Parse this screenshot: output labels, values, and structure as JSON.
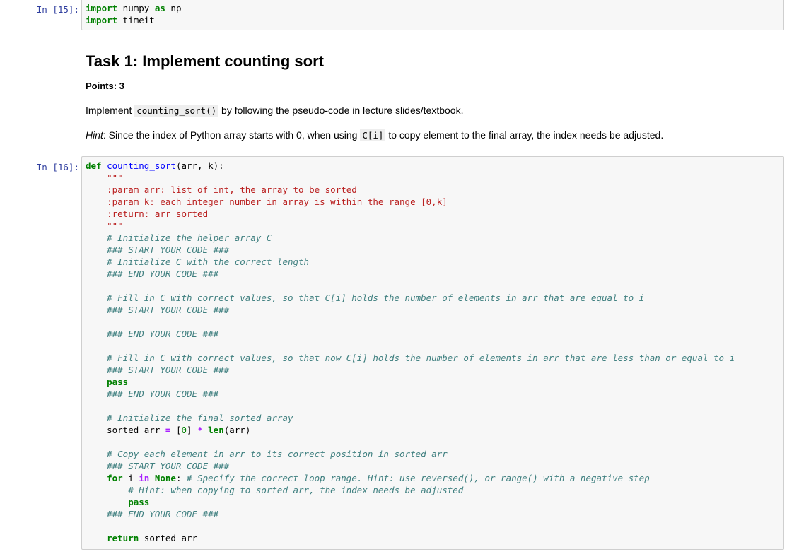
{
  "cell1": {
    "prompt": "In [15]:",
    "lines": [
      [
        [
          "kw",
          "import"
        ],
        [
          "t",
          " numpy "
        ],
        [
          "kw",
          "as"
        ],
        [
          "t",
          " np"
        ]
      ],
      [
        [
          "kw",
          "import"
        ],
        [
          "t",
          " timeit"
        ]
      ]
    ]
  },
  "markdown": {
    "title": "Task 1: Implement counting sort",
    "points": "Points: 3",
    "p1_before": "Implement ",
    "p1_code": "counting_sort()",
    "p1_after": " by following the pseudo-code in lecture slides/textbook.",
    "hint_label": "Hint",
    "hint_before": ": Since the index of Python array starts with 0, when using ",
    "hint_code": "C[i]",
    "hint_after": " to copy element to the final array, the index needs be adjusted."
  },
  "cell2": {
    "prompt": "In [16]:",
    "lines": [
      [
        [
          "kw",
          "def"
        ],
        [
          "t",
          " "
        ],
        [
          "fn",
          "counting_sort"
        ],
        [
          "t",
          "(arr, k):"
        ]
      ],
      [
        [
          "str",
          "    \"\"\""
        ]
      ],
      [
        [
          "str",
          "    :param arr: list of int, the array to be sorted"
        ]
      ],
      [
        [
          "str",
          "    :param k: each integer number in array is within the range [0,k]"
        ]
      ],
      [
        [
          "str",
          "    :return: arr sorted"
        ]
      ],
      [
        [
          "str",
          "    \"\"\""
        ]
      ],
      [
        [
          "cm",
          "    # Initialize the helper array C"
        ]
      ],
      [
        [
          "cm",
          "    ### START YOUR CODE ###"
        ]
      ],
      [
        [
          "cm",
          "    # Initialize C with the correct length"
        ]
      ],
      [
        [
          "cm",
          "    ### END YOUR CODE ###"
        ]
      ],
      [
        [
          "t",
          ""
        ]
      ],
      [
        [
          "cm",
          "    # Fill in C with correct values, so that C[i] holds the number of elements in arr that are equal to i"
        ]
      ],
      [
        [
          "cm",
          "    ### START YOUR CODE ###"
        ]
      ],
      [
        [
          "t",
          ""
        ]
      ],
      [
        [
          "cm",
          "    ### END YOUR CODE ###"
        ]
      ],
      [
        [
          "t",
          ""
        ]
      ],
      [
        [
          "cm",
          "    # Fill in C with correct values, so that now C[i] holds the number of elements in arr that are less than or equal to i"
        ]
      ],
      [
        [
          "cm",
          "    ### START YOUR CODE ###"
        ]
      ],
      [
        [
          "kw",
          "    pass"
        ]
      ],
      [
        [
          "cm",
          "    ### END YOUR CODE ###"
        ]
      ],
      [
        [
          "t",
          ""
        ]
      ],
      [
        [
          "cm",
          "    # Initialize the final sorted array"
        ]
      ],
      [
        [
          "t",
          "    sorted_arr "
        ],
        [
          "op",
          "="
        ],
        [
          "t",
          " ["
        ],
        [
          "num",
          "0"
        ],
        [
          "t",
          "] "
        ],
        [
          "op",
          "*"
        ],
        [
          "t",
          " "
        ],
        [
          "kw",
          "len"
        ],
        [
          "t",
          "(arr)"
        ]
      ],
      [
        [
          "t",
          ""
        ]
      ],
      [
        [
          "cm",
          "    # Copy each element in arr to its correct position in sorted_arr"
        ]
      ],
      [
        [
          "cm",
          "    ### START YOUR CODE ###"
        ]
      ],
      [
        [
          "t",
          "    "
        ],
        [
          "kw",
          "for"
        ],
        [
          "t",
          " i "
        ],
        [
          "op",
          "in"
        ],
        [
          "t",
          " "
        ],
        [
          "kw",
          "None"
        ],
        [
          "t",
          ": "
        ],
        [
          "cm",
          "# Specify the correct loop range. Hint: use reversed(), or range() with a negative step"
        ]
      ],
      [
        [
          "cm",
          "        # Hint: when copying to sorted_arr, the index needs be adjusted"
        ]
      ],
      [
        [
          "kw",
          "        pass"
        ]
      ],
      [
        [
          "cm",
          "    ### END YOUR CODE ###"
        ]
      ],
      [
        [
          "t",
          ""
        ]
      ],
      [
        [
          "t",
          "    "
        ],
        [
          "kw",
          "return"
        ],
        [
          "t",
          " sorted_arr"
        ]
      ]
    ]
  }
}
